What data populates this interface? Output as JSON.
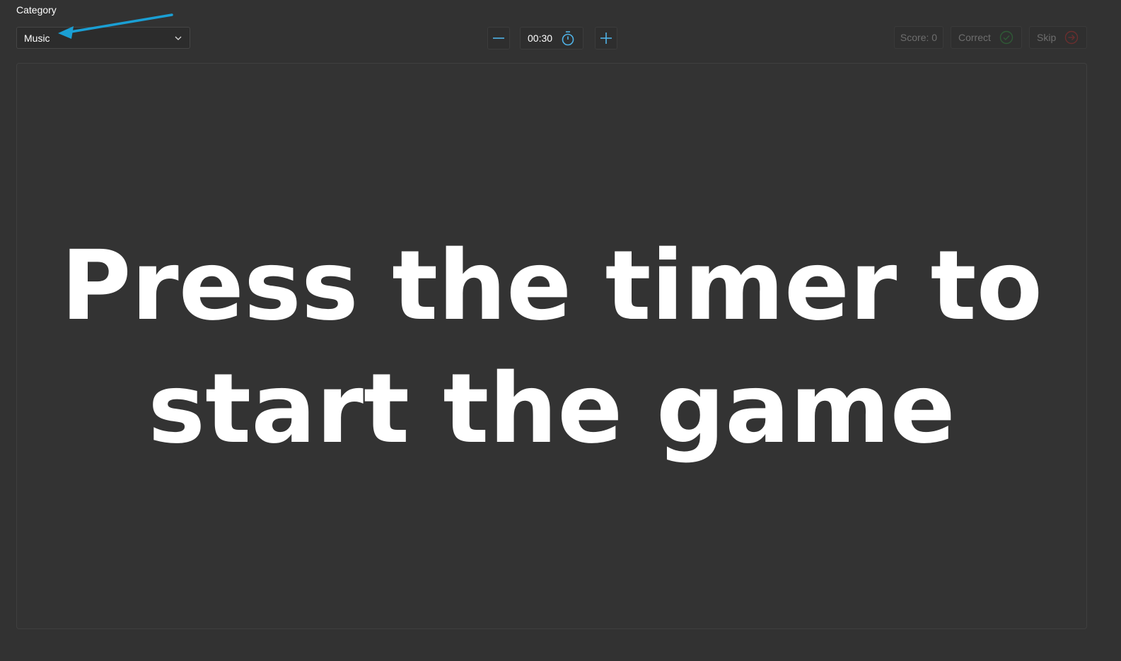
{
  "category": {
    "label": "Category",
    "selected": "Music",
    "chevron_icon": "chevron-down-icon"
  },
  "timer": {
    "decrement_icon": "minus-icon",
    "display": "00:30",
    "timer_icon": "stopwatch-icon",
    "increment_icon": "plus-icon",
    "accent_color": "#4fb3e8"
  },
  "actions": {
    "score_label": "Score: 0",
    "correct_label": "Correct",
    "correct_icon": "check-circle-icon",
    "correct_color": "#2f5a36",
    "skip_label": "Skip",
    "skip_icon": "arrow-right-circle-icon",
    "skip_color": "#6a2e2e"
  },
  "main": {
    "prompt": "Press the timer to start the game"
  },
  "annotation": {
    "arrow_color": "#1a9fd4"
  }
}
